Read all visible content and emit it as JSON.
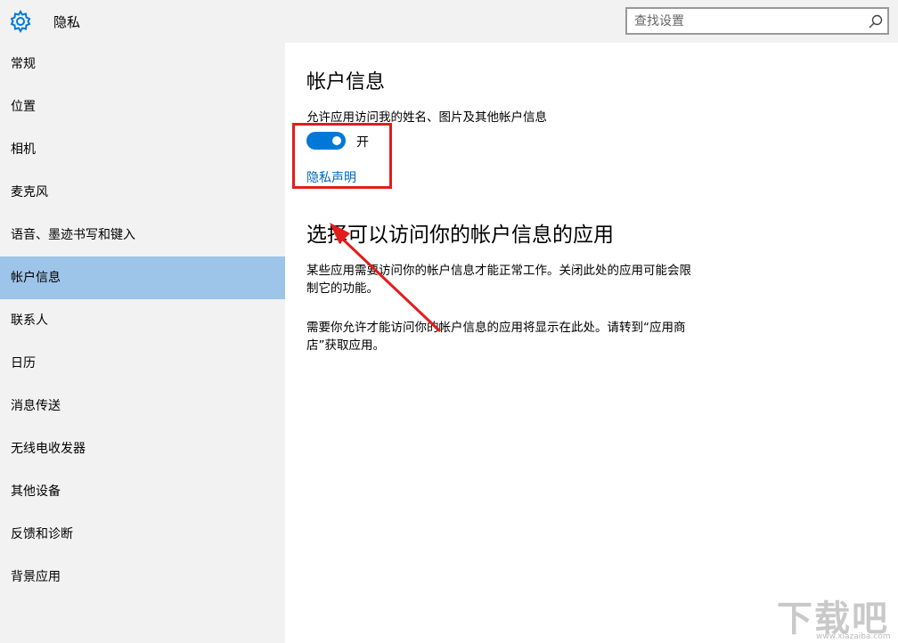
{
  "header": {
    "title": "隐私",
    "search_placeholder": "查找设置"
  },
  "sidebar": {
    "selected_index": 5,
    "items": [
      {
        "label": "常规"
      },
      {
        "label": "位置"
      },
      {
        "label": "相机"
      },
      {
        "label": "麦克风"
      },
      {
        "label": "语音、墨迹书写和键入"
      },
      {
        "label": "帐户信息"
      },
      {
        "label": "联系人"
      },
      {
        "label": "日历"
      },
      {
        "label": "消息传送"
      },
      {
        "label": "无线电收发器"
      },
      {
        "label": "其他设备"
      },
      {
        "label": "反馈和诊断"
      },
      {
        "label": "背景应用"
      }
    ]
  },
  "main": {
    "title": "帐户信息",
    "allow_label": "允许应用访问我的姓名、图片及其他帐户信息",
    "toggle": {
      "on": true,
      "state_label": "开"
    },
    "privacy_link": "隐私声明",
    "section_title": "选择可以访问你的帐户信息的应用",
    "desc1": "某些应用需要访问你的帐户信息才能正常工作。关闭此处的应用可能会限制它的功能。",
    "desc2": "需要你允许才能访问你的帐户信息的应用将显示在此处。请转到“应用商店”获取应用。"
  },
  "colors": {
    "accent": "#0078d7",
    "selected_nav": "#9dc4e9",
    "annotation": "#e31c1c",
    "link": "#0067b8"
  },
  "watermark": {
    "text": "下载吧",
    "sub": "www.xiazaiba.com"
  }
}
